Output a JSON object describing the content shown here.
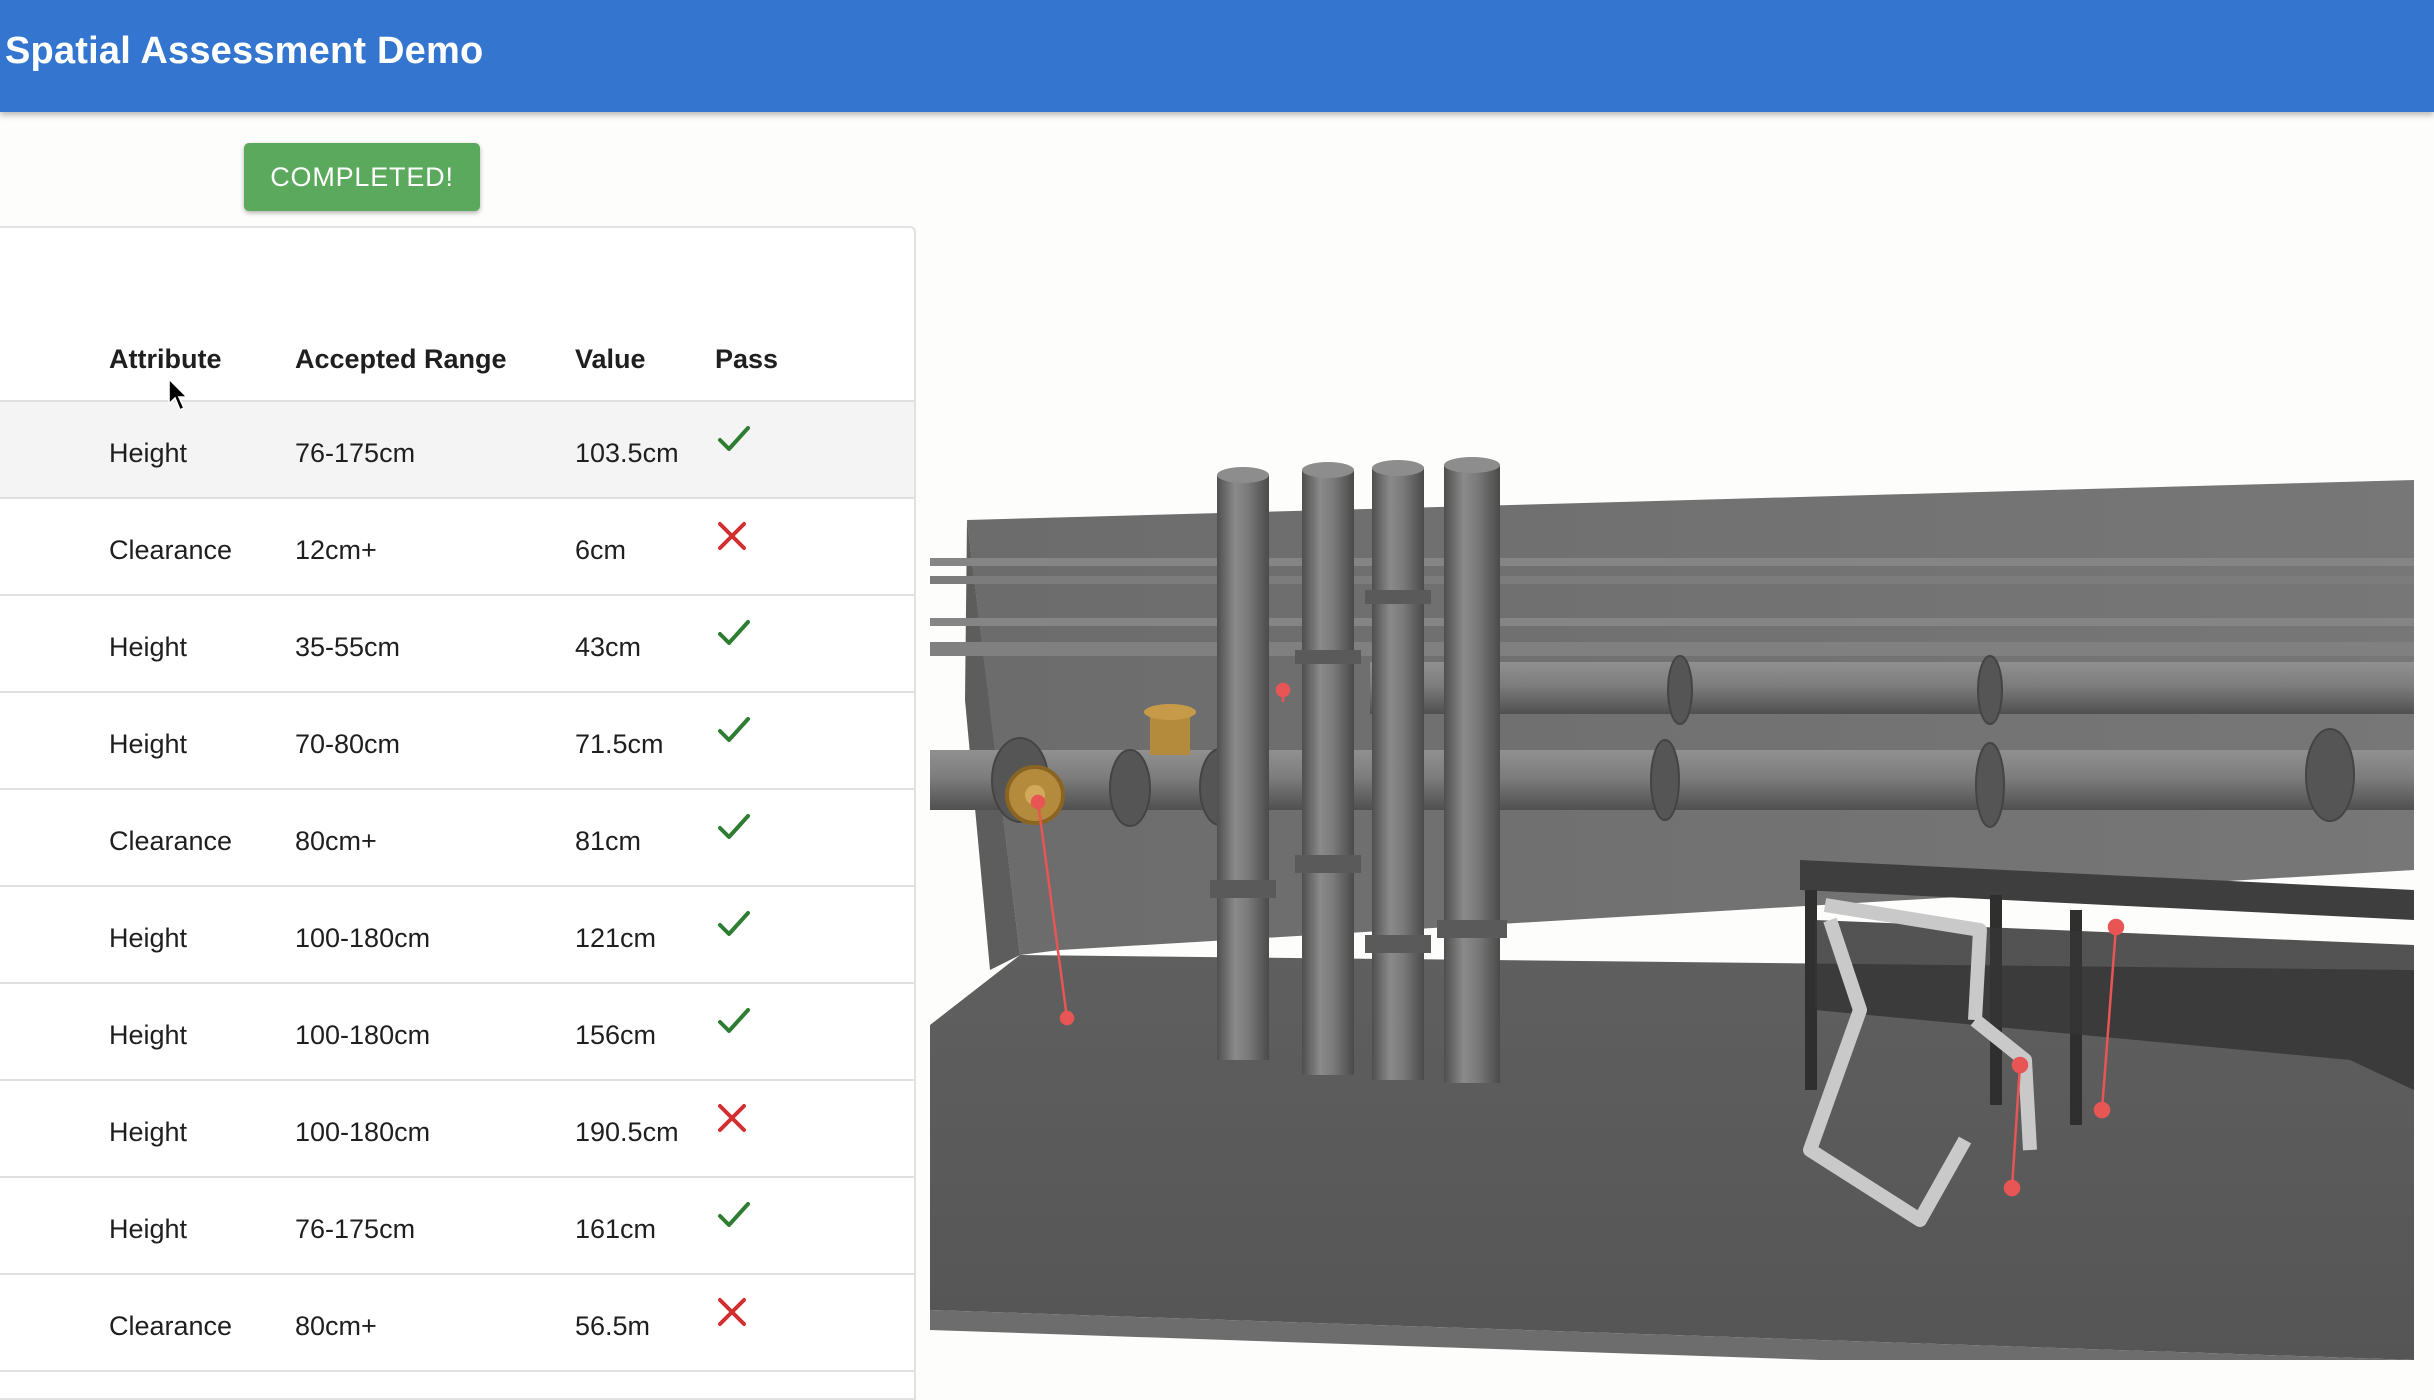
{
  "app": {
    "title": "Spatial Assessment Demo"
  },
  "status_button": {
    "label": "COMPLETED!"
  },
  "table": {
    "headers": [
      "Attribute",
      "Accepted Range",
      "Value",
      "Pass"
    ],
    "rows": [
      {
        "attribute": "Height",
        "range": "76-175cm",
        "value": "103.5cm",
        "pass": true
      },
      {
        "attribute": "Clearance",
        "range": "12cm+",
        "value": "6cm",
        "pass": false
      },
      {
        "attribute": "Height",
        "range": "35-55cm",
        "value": "43cm",
        "pass": true
      },
      {
        "attribute": "Height",
        "range": "70-80cm",
        "value": "71.5cm",
        "pass": true
      },
      {
        "attribute": "Clearance",
        "range": "80cm+",
        "value": "81cm",
        "pass": true
      },
      {
        "attribute": "Height",
        "range": "100-180cm",
        "value": "121cm",
        "pass": true
      },
      {
        "attribute": "Height",
        "range": "100-180cm",
        "value": "156cm",
        "pass": true
      },
      {
        "attribute": "Height",
        "range": "100-180cm",
        "value": "190.5cm",
        "pass": false
      },
      {
        "attribute": "Height",
        "range": "76-175cm",
        "value": "161cm",
        "pass": true
      },
      {
        "attribute": "Clearance",
        "range": "80cm+",
        "value": "56.5m",
        "pass": false
      }
    ]
  },
  "icons": {
    "pass": "checkmark-icon",
    "fail": "cross-icon",
    "pointer": "mouse-pointer-icon"
  },
  "colors": {
    "appbar": "#3476cf",
    "button": "#5aa95c",
    "pass": "#2e7d32",
    "fail": "#d32f2f",
    "marker": "#e85555"
  }
}
